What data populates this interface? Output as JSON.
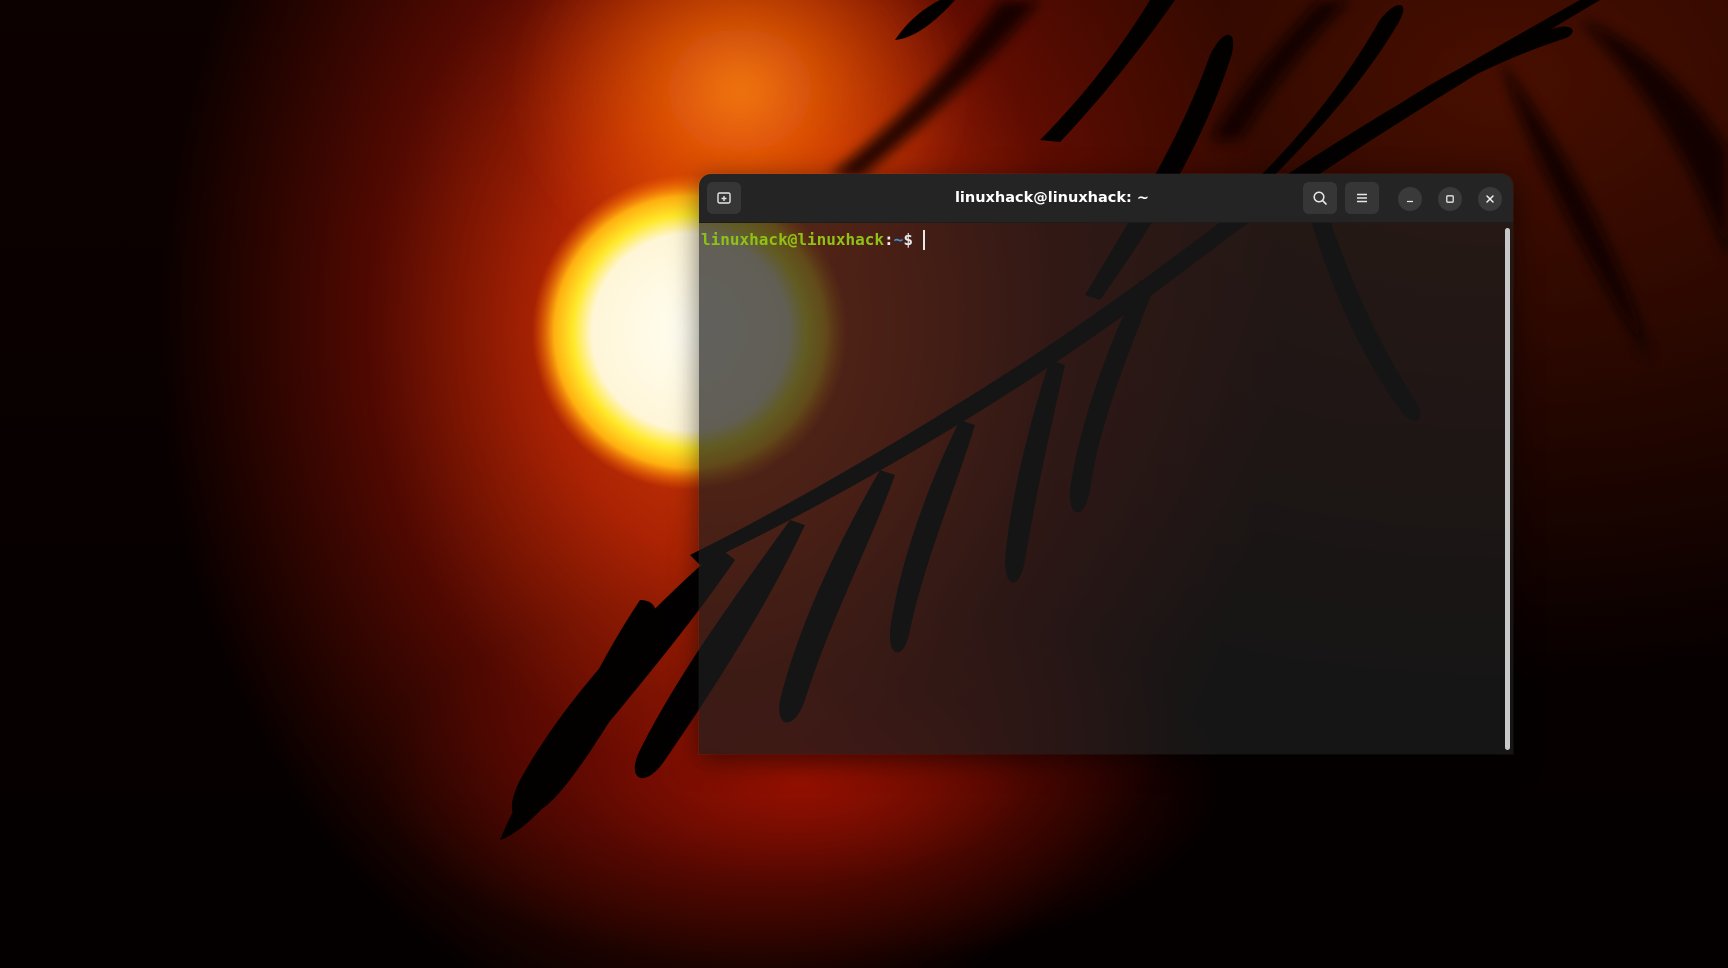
{
  "window": {
    "title": "linuxhack@linuxhack: ~"
  },
  "titlebar": {
    "icons": {
      "new_tab": "new-tab-icon",
      "search": "search-icon",
      "menu": "hamburger-menu-icon",
      "minimize": "minimize-icon",
      "maximize": "maximize-icon",
      "close": "close-icon"
    }
  },
  "terminal": {
    "prompt": {
      "user_host": "linuxhack@linuxhack",
      "separator": ":",
      "path": "~",
      "symbol": "$"
    }
  },
  "colors": {
    "prompt_user": "#8ec214",
    "prompt_path": "#3d8fd6",
    "titlebar_bg": "#242424",
    "terminal_bg": "#1e1e1e",
    "wallpaper_accent": "#e84608"
  }
}
